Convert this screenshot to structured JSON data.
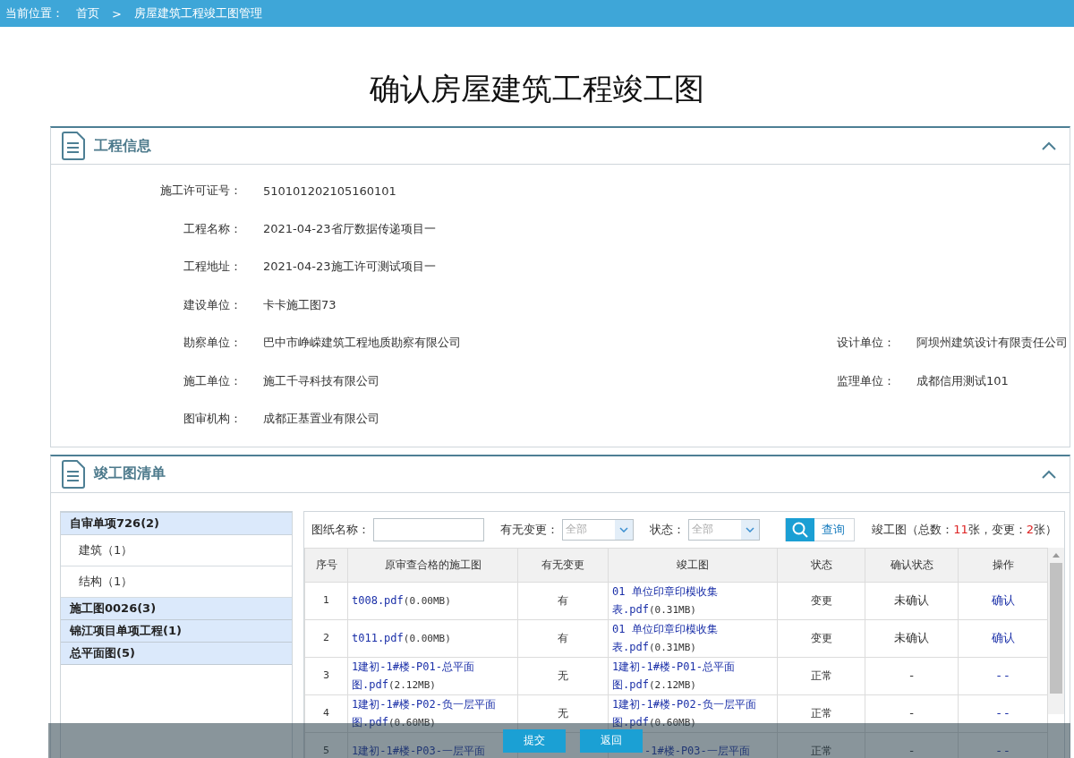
{
  "breadcrumb": {
    "label": "当前位置：",
    "items": [
      "首页",
      "房屋建筑工程竣工图管理"
    ],
    "separator": ">"
  },
  "title": "确认房屋建筑工程竣工图",
  "project_panel": {
    "title": "工程信息",
    "expanded": true,
    "fields": [
      {
        "label": "施工许可证号：",
        "value": "510101202105160101"
      },
      {
        "label": "工程名称：",
        "value": "2021-04-23省厅数据传递项目一"
      },
      {
        "label": "工程地址：",
        "value": "2021-04-23施工许可测试项目一"
      },
      {
        "label": "建设单位：",
        "value": "卡卡施工图73"
      },
      {
        "label": "勘察单位：",
        "value": "巴中市峥嵘建筑工程地质勘察有限公司",
        "label2": "设计单位：",
        "value2": "阿坝州建筑设计有限责任公司"
      },
      {
        "label": "施工单位：",
        "value": "施工千寻科技有限公司",
        "label2": "监理单位：",
        "value2": "成都信用测试101"
      },
      {
        "label": "图审机构：",
        "value": "成都正基置业有限公司"
      }
    ]
  },
  "drawings_panel": {
    "title": "竣工图清单",
    "expanded": true,
    "tree": [
      {
        "label": "自审单项726(2)",
        "expanded": true,
        "children": [
          {
            "label": "建筑（1）"
          },
          {
            "label": "结构（1）"
          }
        ]
      },
      {
        "label": "施工图0026(3)",
        "expanded": false
      },
      {
        "label": "锦江项目单项工程(1)",
        "expanded": false
      },
      {
        "label": "总平面图(5)",
        "expanded": false
      }
    ],
    "filters": {
      "name_label": "图纸名称：",
      "change_label": "有无变更：",
      "change_value": "全部",
      "status_label": "状态：",
      "status_value": "全部",
      "search_button": "查询"
    },
    "summary": {
      "before": "竣工图（总数：",
      "total": "11",
      "middle": "张，变更：",
      "changed": "2",
      "after": "张）"
    },
    "table": {
      "columns": [
        "序号",
        "原审查合格的施工图",
        "有无变更",
        "竣工图",
        "状态",
        "确认状态",
        "操作"
      ],
      "rows": [
        {
          "index": "1",
          "original": {
            "name": "t008.pdf",
            "size": "(0.00MB)"
          },
          "changed": "有",
          "completed": {
            "name": "01 单位印章印模收集表.pdf",
            "size": "(0.31MB)"
          },
          "status": "变更",
          "confirm_status": "未确认",
          "action": "确认"
        },
        {
          "index": "2",
          "original": {
            "name": "t011.pdf",
            "size": "(0.00MB)"
          },
          "changed": "有",
          "completed": {
            "name": "01 单位印章印模收集表.pdf",
            "size": "(0.31MB)"
          },
          "status": "变更",
          "confirm_status": "未确认",
          "action": "确认"
        },
        {
          "index": "3",
          "original": {
            "name": "1建初-1#楼-P01-总平面图.pdf",
            "size": "(2.12MB)"
          },
          "changed": "无",
          "completed": {
            "name": "1建初-1#楼-P01-总平面图.pdf",
            "size": "(2.12MB)"
          },
          "status": "正常",
          "confirm_status": "-",
          "action": "- -"
        },
        {
          "index": "4",
          "original": {
            "name": "1建初-1#楼-P02-负一层平面图.pdf",
            "size": "(0.60MB)"
          },
          "changed": "无",
          "completed": {
            "name": "1建初-1#楼-P02-负一层平面图.pdf",
            "size": "(0.60MB)"
          },
          "status": "正常",
          "confirm_status": "-",
          "action": "- -"
        },
        {
          "index": "5",
          "original": {
            "name": "1建初-1#楼-P03-一层平面"
          },
          "completed": {
            "name": "-1#楼-P03-一层平面"
          },
          "status": "正常",
          "confirm_status": "-",
          "action": "- -"
        }
      ]
    }
  },
  "footer_buttons": [
    "提交",
    "返回"
  ]
}
